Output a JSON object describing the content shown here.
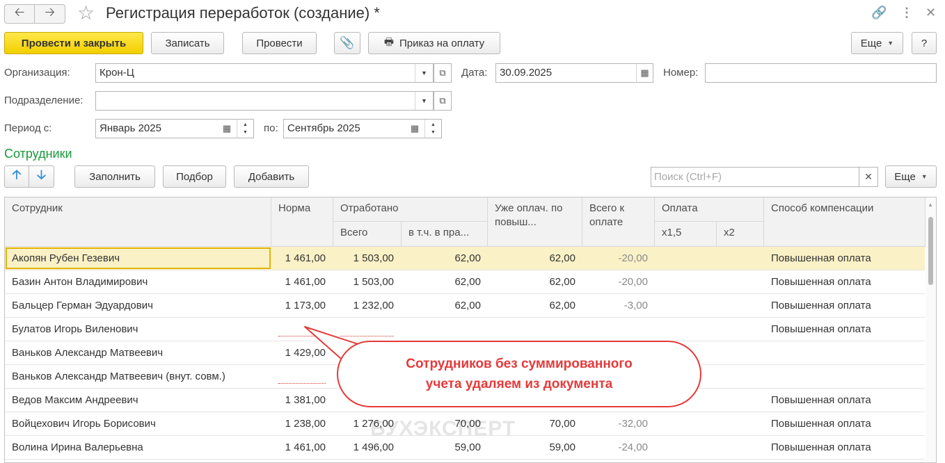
{
  "title": "Регистрация переработок (создание) *",
  "toolbar": {
    "post_close": "Провести и закрыть",
    "save": "Записать",
    "post": "Провести",
    "order": "Приказ на оплату",
    "more": "Еще",
    "help": "?"
  },
  "form": {
    "org_label": "Организация:",
    "org_value": "Крон-Ц",
    "date_label": "Дата:",
    "date_value": "30.09.2025",
    "number_label": "Номер:",
    "number_value": "",
    "dept_label": "Подразделение:",
    "dept_value": "",
    "period_from_label": "Период с:",
    "period_from": "Январь 2025",
    "period_to_label": "по:",
    "period_to": "Сентябрь 2025"
  },
  "section_title": "Сотрудники",
  "table_toolbar": {
    "fill": "Заполнить",
    "pick": "Подбор",
    "add": "Добавить",
    "search_placeholder": "Поиск (Ctrl+F)",
    "more": "Еще"
  },
  "columns": {
    "employee": "Сотрудник",
    "norm": "Норма",
    "worked": "Отработано",
    "worked_total": "Всего",
    "worked_holidays": "в т.ч. в пра...",
    "already_paid": "Уже оплач. по повыш...",
    "total_to_pay": "Всего к оплате",
    "payment": "Оплата",
    "x15": "х1,5",
    "x2": "х2",
    "compensation": "Способ компенсации"
  },
  "rows": [
    {
      "name": "Акопян Рубен Гезевич",
      "norm": "1 461,00",
      "total": "1 503,00",
      "holidays": "62,00",
      "paid": "62,00",
      "to_pay": "-20,00",
      "comp": "Повышенная оплата"
    },
    {
      "name": "Базин Антон Владимирович",
      "norm": "1 461,00",
      "total": "1 503,00",
      "holidays": "62,00",
      "paid": "62,00",
      "to_pay": "-20,00",
      "comp": "Повышенная оплата"
    },
    {
      "name": "Бальцер Герман Эдуардович",
      "norm": "1 173,00",
      "total": "1 232,00",
      "holidays": "62,00",
      "paid": "62,00",
      "to_pay": "-3,00",
      "comp": "Повышенная оплата"
    },
    {
      "name": "Булатов Игорь Виленович",
      "norm": "",
      "total": "",
      "holidays": "",
      "paid": "",
      "to_pay": "",
      "comp": "Повышенная оплата"
    },
    {
      "name": "Ваньков Александр Матвеевич",
      "norm": "1 429,00",
      "total": "",
      "holidays": "",
      "paid": "",
      "to_pay": "",
      "comp": ""
    },
    {
      "name": "Ваньков Александр Матвеевич (внут. совм.)",
      "norm": "",
      "total": "",
      "holidays": "",
      "paid": "",
      "to_pay": "",
      "comp": ""
    },
    {
      "name": "Ведов Максим Андреевич",
      "norm": "1 381,00",
      "total": "",
      "holidays": "",
      "paid": "",
      "to_pay": "",
      "comp": "Повышенная оплата"
    },
    {
      "name": "Войцехович Игорь Борисович",
      "norm": "1 238,00",
      "total": "1 276,00",
      "holidays": "70,00",
      "paid": "70,00",
      "to_pay": "-32,00",
      "comp": "Повышенная оплата"
    },
    {
      "name": "Волина Ирина Валерьевна",
      "norm": "1 461,00",
      "total": "1 496,00",
      "holidays": "59,00",
      "paid": "59,00",
      "to_pay": "-24,00",
      "comp": "Повышенная оплата"
    }
  ],
  "watermark": "БУХЭКСПЕРТ",
  "callout": {
    "line1": "Сотрудников без суммированного",
    "line2": "учета удаляем из документа"
  }
}
